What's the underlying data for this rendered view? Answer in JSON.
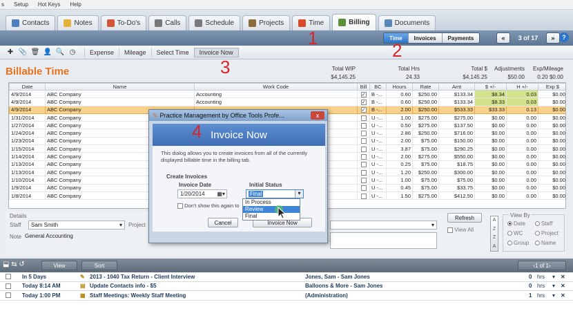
{
  "menu": [
    "s",
    "Setup",
    "Hot Keys",
    "Help"
  ],
  "tabs": [
    {
      "label": "Contacts",
      "icon": "contacts-icon",
      "color": "#4a7fc1"
    },
    {
      "label": "Notes",
      "icon": "notes-icon",
      "color": "#e2b23a"
    },
    {
      "label": "To-Do's",
      "icon": "todo-icon",
      "color": "#d4553a"
    },
    {
      "label": "Calls",
      "icon": "phone-icon",
      "color": "#777777"
    },
    {
      "label": "Schedule",
      "icon": "calendar-icon",
      "color": "#7a7a7a"
    },
    {
      "label": "Projects",
      "icon": "projects-icon",
      "color": "#8a6d3b"
    },
    {
      "label": "Time",
      "icon": "clock-icon",
      "color": "#d84a2a"
    },
    {
      "label": "Billing",
      "icon": "billing-icon",
      "color": "#5b8f3a"
    },
    {
      "label": "Documents",
      "icon": "documents-icon",
      "color": "#5a86b8"
    }
  ],
  "subbar": {
    "segments": [
      "Time",
      "Invoices",
      "Payments"
    ],
    "active": "Time",
    "prev": "«",
    "next": "»",
    "counter": "3 of 17",
    "help": "?"
  },
  "toolbar": {
    "links": [
      "Expense",
      "Mileage",
      "Select Time",
      "Invoice Now"
    ],
    "selected": "Invoice Now"
  },
  "annotations": [
    "1",
    "2",
    "3",
    "4"
  ],
  "page_title": "Billable Time",
  "totals": [
    {
      "label": "Total WIP",
      "value": "$4,145.25"
    },
    {
      "label": "Total Hrs",
      "value": "24.33"
    },
    {
      "label": "Total $",
      "value": "$4,145.25"
    },
    {
      "label": "Adjustments",
      "value": "$50.00"
    },
    {
      "label": "Exp/Mileage",
      "value": "0.20 $0.00"
    }
  ],
  "grid": {
    "columns": [
      "Date",
      "Name",
      "Work Code",
      "Bill",
      "BC",
      "Hours",
      "Rate",
      "Amt",
      "$ +/-",
      "H +/-",
      "Exp $"
    ],
    "rows": [
      {
        "date": "4/9/2014",
        "name": "ABC Company",
        "work": "Accounting",
        "bill": true,
        "bc": "B -...",
        "hours": "0.60",
        "rate": "$250.00",
        "amt": "$133.34",
        "dpm": "$8.34",
        "hpm": "0.03",
        "exp": "$0.00",
        "hl": true
      },
      {
        "date": "4/9/2014",
        "name": "ABC Company",
        "work": "Accounting",
        "bill": true,
        "bc": "B -...",
        "hours": "0.60",
        "rate": "$250.00",
        "amt": "$133.34",
        "dpm": "$8.33",
        "hpm": "0.03",
        "exp": "$0.00",
        "hl": true
      },
      {
        "date": "4/9/2014",
        "name": "ABC Company",
        "work": "",
        "bill": true,
        "bc": "B -...",
        "hours": "2.00",
        "rate": "$250.00",
        "amt": "$533.33",
        "dpm": "$33.33",
        "hpm": "0.13",
        "exp": "$0.00",
        "hl": true,
        "sel": true
      },
      {
        "date": "1/31/2014",
        "name": "ABC Company",
        "work": "",
        "bill": false,
        "bc": "U -...",
        "hours": "1.00",
        "rate": "$275.00",
        "amt": "$275.00",
        "dpm": "$0.00",
        "hpm": "0.00",
        "exp": "$0.00"
      },
      {
        "date": "1/27/2014",
        "name": "ABC Company",
        "work": "",
        "bill": false,
        "bc": "U -...",
        "hours": "0.50",
        "rate": "$275.00",
        "amt": "$137.50",
        "dpm": "$0.00",
        "hpm": "0.00",
        "exp": "$0.00"
      },
      {
        "date": "1/24/2014",
        "name": "ABC Company",
        "work": "",
        "bill": false,
        "bc": "U -...",
        "hours": "2.86",
        "rate": "$250.00",
        "amt": "$716.00",
        "dpm": "$0.00",
        "hpm": "0.00",
        "exp": "$0.00"
      },
      {
        "date": "1/23/2014",
        "name": "ABC Company",
        "work": "",
        "bill": false,
        "bc": "U -...",
        "hours": "2.00",
        "rate": "$75.00",
        "amt": "$150.00",
        "dpm": "$0.00",
        "hpm": "0.00",
        "exp": "$0.00"
      },
      {
        "date": "1/15/2014",
        "name": "ABC Company",
        "work": "",
        "bill": false,
        "bc": "U -...",
        "hours": "3.87",
        "rate": "$75.00",
        "amt": "$290.25",
        "dpm": "$0.00",
        "hpm": "0.00",
        "exp": "$0.00"
      },
      {
        "date": "1/14/2014",
        "name": "ABC Company",
        "work": "",
        "bill": false,
        "bc": "U -...",
        "hours": "2.00",
        "rate": "$275.00",
        "amt": "$550.00",
        "dpm": "$0.00",
        "hpm": "0.00",
        "exp": "$0.00"
      },
      {
        "date": "1/13/2014",
        "name": "ABC Company",
        "work": "",
        "bill": false,
        "bc": "U -...",
        "hours": "0.25",
        "rate": "$75.00",
        "amt": "$18.75",
        "dpm": "$0.00",
        "hpm": "0.00",
        "exp": "$0.00"
      },
      {
        "date": "1/13/2014",
        "name": "ABC Company",
        "work": "",
        "bill": false,
        "bc": "U -...",
        "hours": "1.20",
        "rate": "$250.00",
        "amt": "$300.00",
        "dpm": "$0.00",
        "hpm": "0.00",
        "exp": "$0.00"
      },
      {
        "date": "1/10/2014",
        "name": "ABC Company",
        "work": "",
        "bill": false,
        "bc": "U -...",
        "hours": "1.00",
        "rate": "$75.00",
        "amt": "$75.00",
        "dpm": "$0.00",
        "hpm": "0.00",
        "exp": "$0.00"
      },
      {
        "date": "1/9/2014",
        "name": "ABC Company",
        "work": "",
        "bill": false,
        "bc": "U -...",
        "hours": "0.45",
        "rate": "$75.00",
        "amt": "$33.75",
        "dpm": "$0.00",
        "hpm": "0.00",
        "exp": "$0.00"
      },
      {
        "date": "1/8/2014",
        "name": "ABC Company",
        "work": "",
        "bill": false,
        "bc": "U -...",
        "hours": "1.50",
        "rate": "$275.00",
        "amt": "$412.50",
        "dpm": "$0.00",
        "hpm": "0.00",
        "exp": "$0.00"
      }
    ]
  },
  "details": {
    "legend": "Details",
    "staff_label": "Staff",
    "staff_value": "Sam Smith",
    "project_label": "Project",
    "note_label": "Note",
    "note_value": "General Accounting",
    "refresh": "Refresh",
    "view_all": "View All",
    "az": [
      "A",
      "Z",
      "Z",
      "A"
    ],
    "view_by_legend": "View By",
    "view_by": [
      "Date",
      "Staff",
      "WC",
      "Project",
      "Group",
      "Name"
    ],
    "view_by_selected": "Date"
  },
  "bottom": {
    "view": "View",
    "sort": "Sort",
    "pager": "1 of 1",
    "rows": [
      {
        "when": "In 5 Days",
        "title": "2013 - 1040 Tax Return - Client Interview",
        "who": "Jones, Sam - Sam  Jones",
        "num": "0",
        "unit": "hrs"
      },
      {
        "when": "Today 8:14 AM",
        "title": "Update Contacts info - $5",
        "who": "Balloons & More - Sam  Jones",
        "num": "0",
        "unit": "hrs"
      },
      {
        "when": "Today 1:00 PM",
        "title": "Staff Meetings: Weekly Staff Meeting",
        "who": "(Administration)",
        "num": "1",
        "unit": "hrs"
      }
    ]
  },
  "dialog": {
    "title": "Practice Management by Office Tools Profe...",
    "heading": "Invoice Now",
    "description": "This dialog allows you to create invoices from all of the currently displayed billable time in the billing tab.",
    "section": "Create Invoices",
    "date_label": "Invoice Date",
    "date_value": "1/20/2014",
    "status_label": "Initial Status",
    "status_value": "Final",
    "options": [
      "In Process",
      "Review",
      "Final"
    ],
    "highlighted": "Review",
    "dont_show": "Don't show this again to",
    "cancel": "Cancel",
    "ok": "Invoice Now",
    "close": "x"
  }
}
